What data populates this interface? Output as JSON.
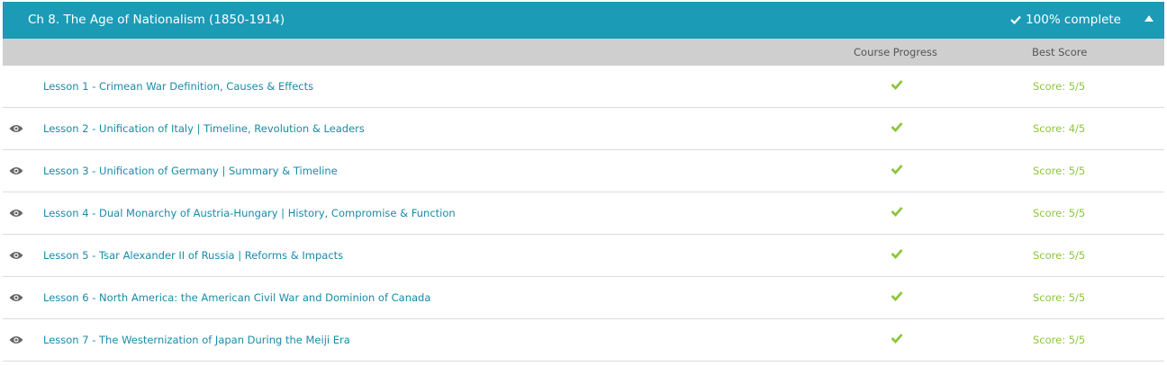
{
  "chapter": {
    "title": "Ch 8. The Age of Nationalism (1850-1914)",
    "complete_label": "100% complete",
    "accent": "#1b9bb6",
    "success": "#8cc63e"
  },
  "columns": {
    "progress": "Course Progress",
    "score": "Best Score"
  },
  "lessons": [
    {
      "title": "Lesson 1 - Crimean War Definition, Causes & Effects",
      "score": "Score: 5/5",
      "viewed_icon": false,
      "complete": true
    },
    {
      "title": "Lesson 2 - Unification of Italy | Timeline, Revolution & Leaders",
      "score": "Score: 4/5",
      "viewed_icon": true,
      "complete": true
    },
    {
      "title": "Lesson 3 - Unification of Germany | Summary & Timeline",
      "score": "Score: 5/5",
      "viewed_icon": true,
      "complete": true
    },
    {
      "title": "Lesson 4 - Dual Monarchy of Austria-Hungary | History, Compromise & Function",
      "score": "Score: 5/5",
      "viewed_icon": true,
      "complete": true
    },
    {
      "title": "Lesson 5 - Tsar Alexander II of Russia | Reforms & Impacts",
      "score": "Score: 5/5",
      "viewed_icon": true,
      "complete": true
    },
    {
      "title": "Lesson 6 - North America: the American Civil War and Dominion of Canada",
      "score": "Score: 5/5",
      "viewed_icon": true,
      "complete": true
    },
    {
      "title": "Lesson 7 - The Westernization of Japan During the Meiji Era",
      "score": "Score: 5/5",
      "viewed_icon": true,
      "complete": true
    }
  ]
}
